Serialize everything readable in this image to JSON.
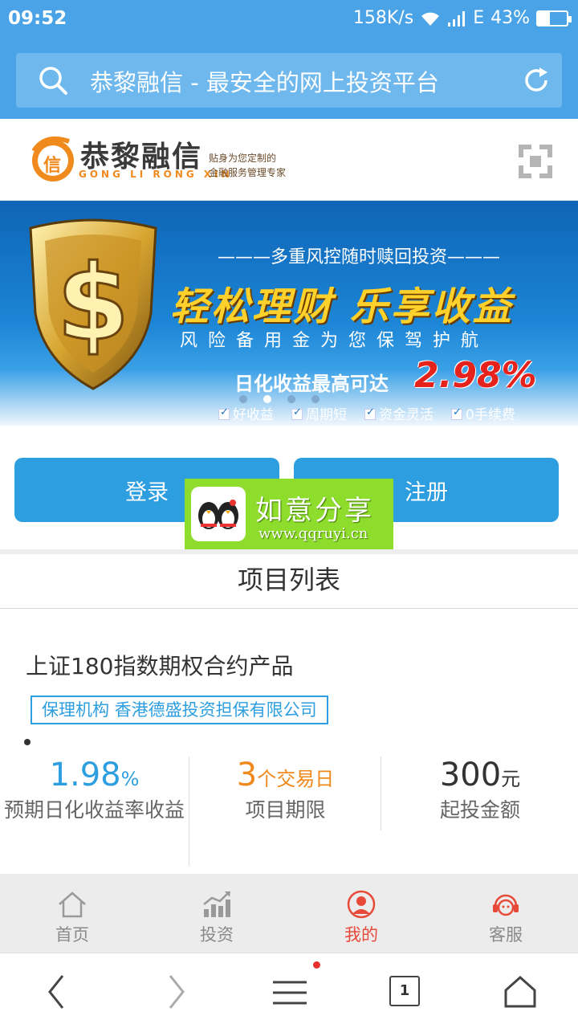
{
  "status_bar": {
    "time": "09:52",
    "network_speed": "158K/s",
    "network_type": "E",
    "battery_percent": "43%",
    "battery_level": 0.43
  },
  "browser": {
    "address_title": "恭黎融信 - 最安全的网上投资平台",
    "tab_count": "1"
  },
  "site_header": {
    "logo_name": "恭黎融信",
    "logo_badge_char": "信",
    "logo_pinyin": "GONG LI RONG XIN",
    "slogan_line1": "贴身为您定制的",
    "slogan_line2": "金融服务管理专家"
  },
  "banner": {
    "subtitle_top": "———多重风控随时赎回投资———",
    "headline": "轻松理财 乐享收益",
    "subtitle_mid": "风险备用金为您保驾护航",
    "yield_text": "日化收益最高可达",
    "yield_value": "2.98%",
    "features": [
      "好收益",
      "周期短",
      "资金灵活",
      "0手续费"
    ],
    "slide_count": 4,
    "active_slide": 2
  },
  "auth": {
    "login_label": "登录",
    "register_label": "注册"
  },
  "watermark": {
    "title": "如意分享",
    "url": "www.qqruyi.cn"
  },
  "section": {
    "title": "项目列表"
  },
  "product": {
    "name": "上证180指数期权合约产品",
    "guarantor": "保理机构  香港德盛投资担保有限公司",
    "stats": [
      {
        "value": "1.98",
        "unit": "%",
        "label": "预期日化收益率收益"
      },
      {
        "value": "3",
        "unit": "个交易日",
        "label": "项目期限"
      },
      {
        "value": "300",
        "unit": "元",
        "label": "起投金额"
      }
    ]
  },
  "app_nav": {
    "items": [
      {
        "label": "首页",
        "icon": "home-icon"
      },
      {
        "label": "投资",
        "icon": "chart-icon"
      },
      {
        "label": "我的",
        "icon": "user-icon"
      },
      {
        "label": "客服",
        "icon": "headset-icon"
      }
    ],
    "active_index": 2
  },
  "colors": {
    "primary_blue": "#2d9ee0",
    "status_blue": "#4aa3e6",
    "accent_orange": "#f0891b",
    "active_red": "#e84a3a",
    "watermark_green": "#8edc2c"
  }
}
